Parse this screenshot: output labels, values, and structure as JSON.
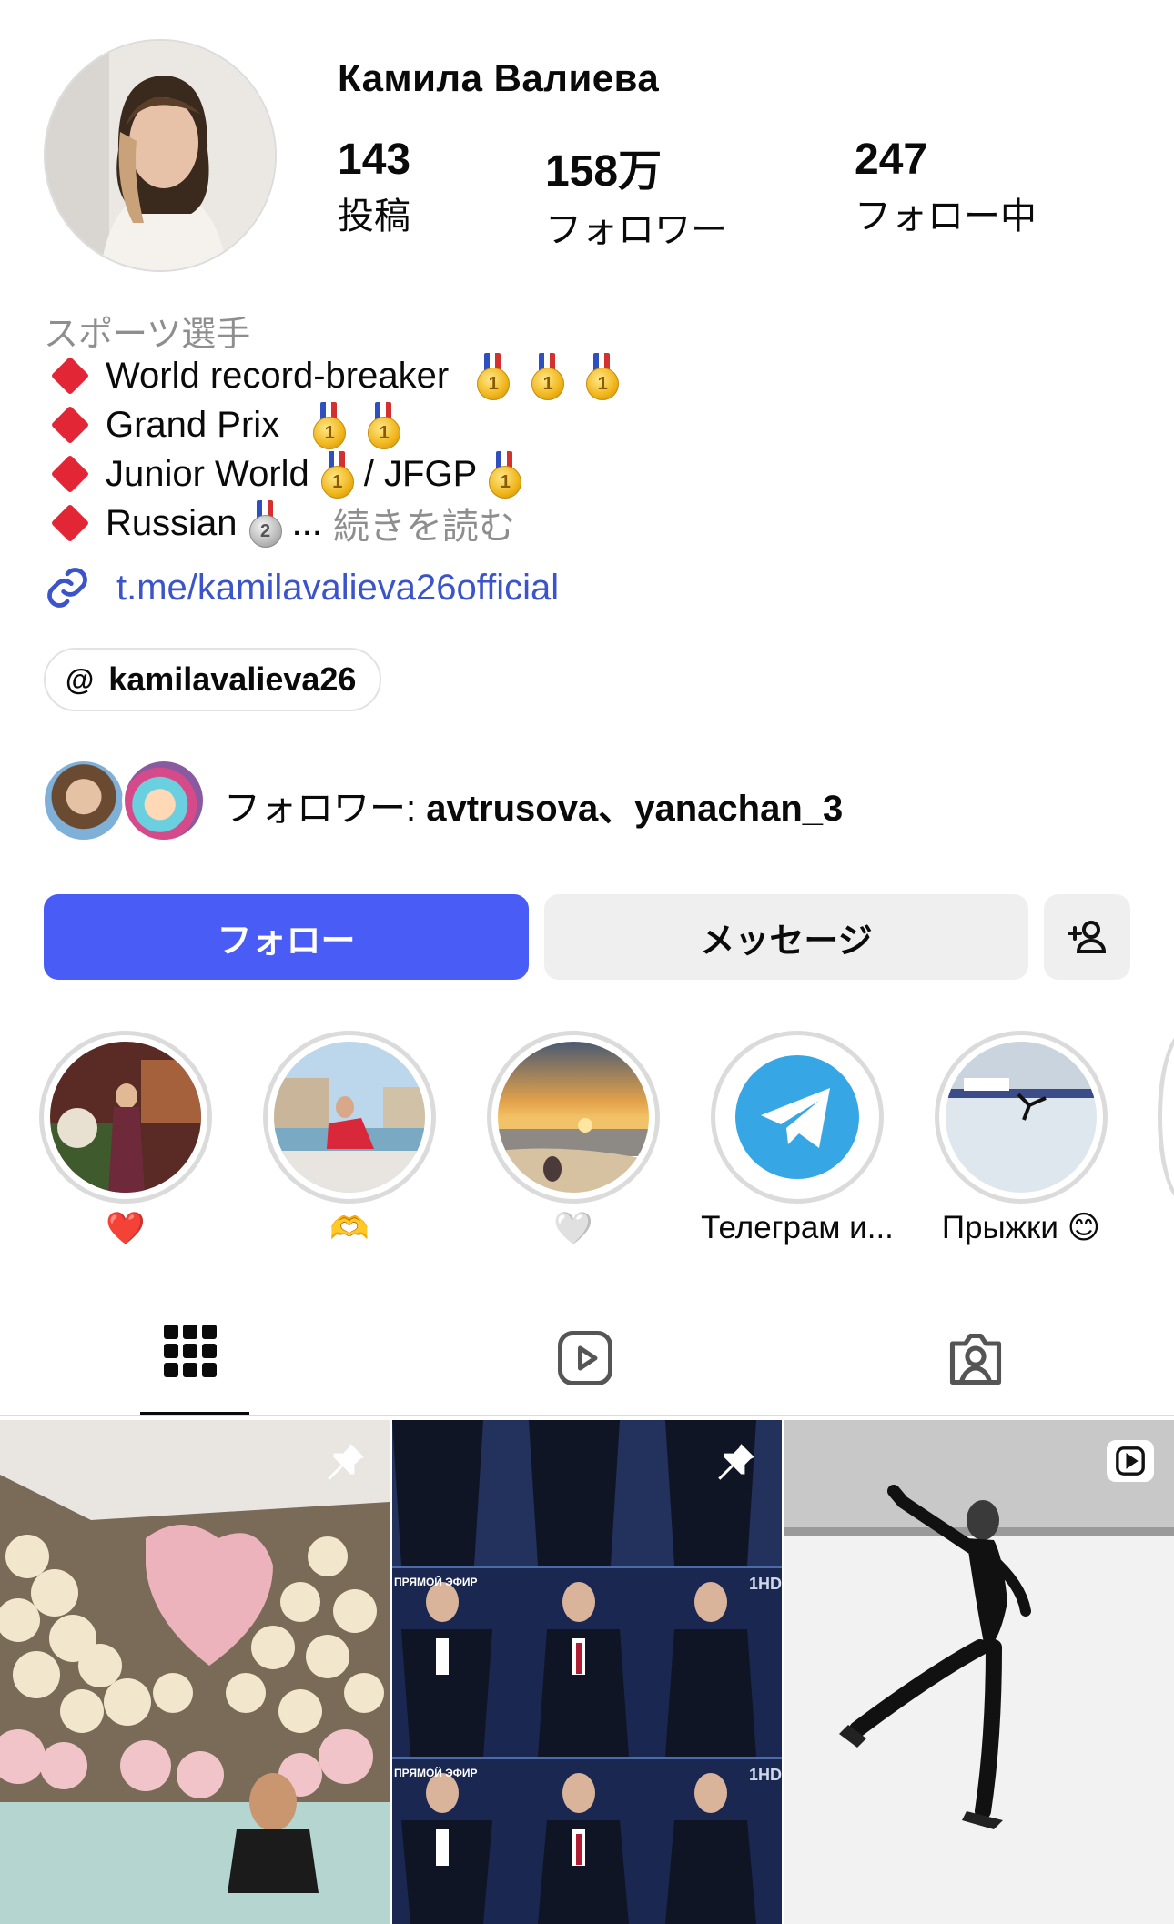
{
  "profile": {
    "name": "Камила Валиева",
    "stats": [
      {
        "value": "143",
        "label": "投稿"
      },
      {
        "value": "158万",
        "label": "フォロワー"
      },
      {
        "value": "247",
        "label": "フォロー中"
      }
    ],
    "category": "スポーツ選手",
    "bio": {
      "line1": "World record-breaker",
      "line2": "Grand Prix",
      "line3a": "Junior World",
      "line3b": "/ JFGP",
      "line4": "Russian",
      "ellipsis": "...",
      "more": "続きを読む",
      "silver_medal_number": "2",
      "gold_medal_number": "1"
    },
    "link": "t.me/kamilavalieva26official",
    "threads_handle": "kamilavalieva26",
    "followed_by": {
      "prefix": "フォロワー: ",
      "names": "avtrusova、yanachan_3"
    }
  },
  "buttons": {
    "follow": "フォロー",
    "message": "メッセージ",
    "add_user_icon": "add-person-icon"
  },
  "highlights": [
    {
      "label": "❤️",
      "icon": "photo"
    },
    {
      "label": "🫶",
      "icon": "photo"
    },
    {
      "label": "🤍",
      "icon": "photo"
    },
    {
      "label": "Телеграм и...",
      "icon": "telegram-icon"
    },
    {
      "label": "Прыжки 😊",
      "icon": "photo"
    }
  ],
  "tabs": [
    {
      "name": "grid",
      "icon": "grid-icon",
      "active": true
    },
    {
      "name": "reels",
      "icon": "reels-icon",
      "active": false
    },
    {
      "name": "tagged",
      "icon": "tagged-icon",
      "active": false
    }
  ],
  "posts": [
    {
      "badge": "pin-icon"
    },
    {
      "badge": "pin-icon",
      "overlay_text": "ПРЯМОЙ ЭФИР",
      "channel_text": "1HD"
    },
    {
      "badge": "reel-icon"
    }
  ],
  "colors": {
    "accent": "#4a5cf6",
    "link": "#3b54c9",
    "muted": "#8e8e8e",
    "diamond": "#e32636"
  }
}
